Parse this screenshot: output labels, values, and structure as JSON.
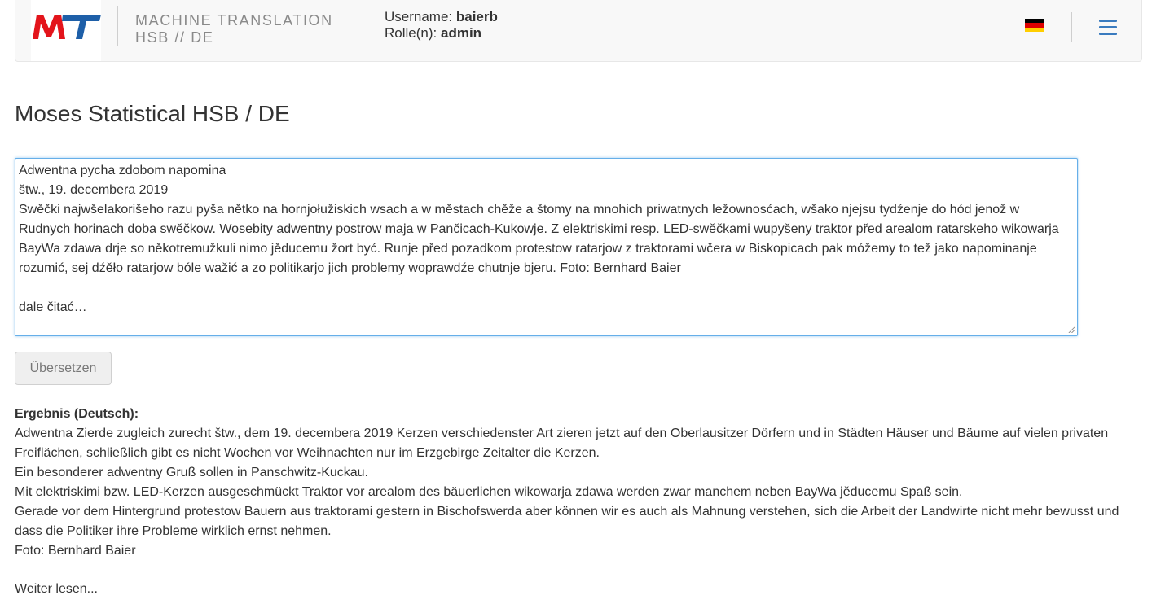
{
  "colors": {
    "logo_red": "#e3141b",
    "logo_blue": "#1e5fa8",
    "accent": "#3a7bbf"
  },
  "header": {
    "logo_text": "MT",
    "brand_line1": "MACHINE TRANSLATION",
    "brand_line2": "HSB // DE",
    "username_label": "Username:",
    "username_value": "baierb",
    "role_label": "Rolle(n):",
    "role_value": "admin",
    "language_icon": "german-flag-icon",
    "menu_icon": "hamburger-menu-icon"
  },
  "main": {
    "title": "Moses Statistical HSB / DE",
    "source_text": "Adwentna pycha zdobom napomina\nštw., 19. decembera 2019\nSwěčki najwšelakorišeho razu pyša nětko na hornjołužiskich wsach a w městach chěže a štomy na mnohich priwatnych ležownosćach, wšako njejsu tydźenje do hód jenož w Rudnych horinach doba swěčkow. Wosebity adwentny postrow maja w Pančicach-Kukowje. Z elektriskimi resp. LED-swěčkami wupyšeny traktor před arealom ratarskeho wikowarja BayWa zdawa drje so někotremužkuli nimo jěducemu žort być. Runje před pozadkom protestow ratarjow z traktorami wčera w Biskopicach pak móžemy to tež jako napominanje rozumić, sej dźěło ratarjow bóle wažić a zo politikarjo jich problemy woprawdźe chutnje bjeru. Foto: Bernhard Baier\n\ndale čitać…",
    "translate_button": "Übersetzen",
    "result_title": "Ergebnis (Deutsch):",
    "result_lines": [
      "Adwentna Zierde zugleich zurecht štw., dem 19. decembera 2019 Kerzen verschiedenster Art zieren jetzt auf den Oberlausitzer Dörfern und in Städten Häuser und Bäume auf vielen privaten Freiflächen, schließlich gibt es nicht Wochen vor Weihnachten nur im Erzgebirge Zeitalter die Kerzen.",
      "Ein besonderer adwentny Gruß sollen in Panschwitz-Kuckau.",
      "Mit elektriskimi bzw. LED-Kerzen ausgeschmückt Traktor vor arealom des bäuerlichen wikowarja zdawa werden zwar manchem neben BayWa jěducemu Spaß sein.",
      "Gerade vor dem Hintergrund protestow Bauern aus traktorami gestern in Bischofswerda aber können wir es auch als Mahnung verstehen, sich die Arbeit der Landwirte nicht mehr bewusst und dass die Politiker ihre Probleme wirklich ernst nehmen.",
      "Foto: Bernhard Baier"
    ],
    "read_more": "Weiter lesen..."
  }
}
